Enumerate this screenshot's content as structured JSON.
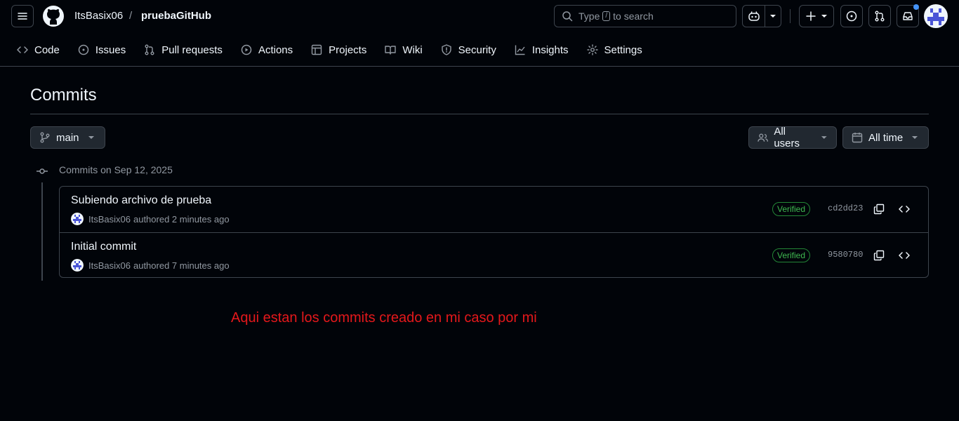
{
  "header": {
    "owner": "ItsBasix06",
    "separator": "/",
    "repo": "pruebaGitHub",
    "search_prefix": "Type",
    "search_key": "/",
    "search_suffix": "to search"
  },
  "tabs": [
    {
      "label": "Code",
      "icon": "code-icon"
    },
    {
      "label": "Issues",
      "icon": "issue-icon"
    },
    {
      "label": "Pull requests",
      "icon": "pull-request-icon"
    },
    {
      "label": "Actions",
      "icon": "play-icon"
    },
    {
      "label": "Projects",
      "icon": "table-icon"
    },
    {
      "label": "Wiki",
      "icon": "book-icon"
    },
    {
      "label": "Security",
      "icon": "shield-icon"
    },
    {
      "label": "Insights",
      "icon": "graph-icon"
    },
    {
      "label": "Settings",
      "icon": "gear-icon"
    }
  ],
  "page": {
    "title": "Commits",
    "branch": "main",
    "users_filter": "All users",
    "time_filter": "All time"
  },
  "commit_group": {
    "label": "Commits on Sep 12, 2025",
    "commits": [
      {
        "message": "Subiendo archivo de prueba",
        "author": "ItsBasix06",
        "time": "authored 2 minutes ago",
        "badge": "Verified",
        "sha": "cd2dd23"
      },
      {
        "message": "Initial commit",
        "author": "ItsBasix06",
        "time": "authored 7 minutes ago",
        "badge": "Verified",
        "sha": "9580780"
      }
    ]
  },
  "annotation": "Aqui estan los commits creado en mi caso por mi",
  "colors": {
    "background": "#010409",
    "border": "#3d444d",
    "verified": "#3fb950",
    "annotation": "#e5181b",
    "notification_dot": "#4493f8"
  }
}
